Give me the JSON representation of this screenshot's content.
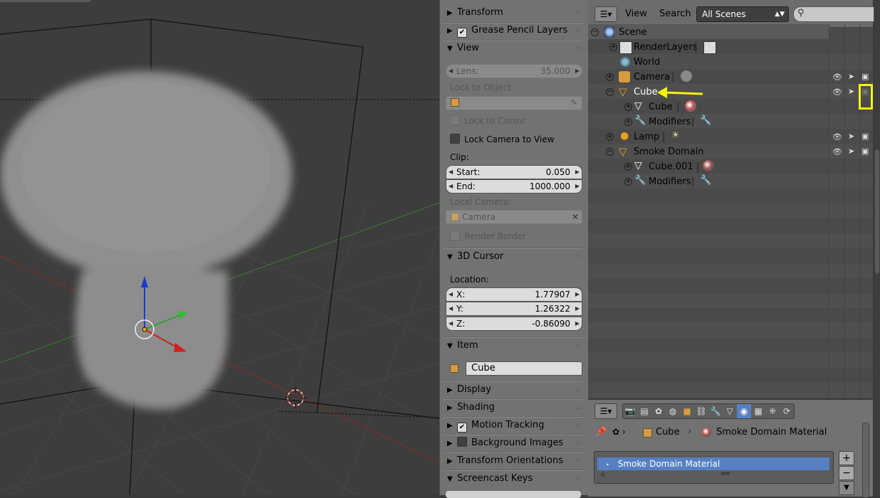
{
  "npanel": {
    "transform": "Transform",
    "grease_pencil": "Grease Pencil Layers",
    "view": "View",
    "lens_label": "Lens:",
    "lens_value": "35.000",
    "lock_to_object": "Lock to Object:",
    "lock_to_cursor": "Lock to Cursor",
    "lock_camera": "Lock Camera to View",
    "clip": "Clip:",
    "start_label": "Start:",
    "start_value": "0.050",
    "end_label": "End:",
    "end_value": "1000.000",
    "local_camera": "Local Camera:",
    "camera_field": "Camera",
    "render_border": "Render Border",
    "cursor3d": "3D Cursor",
    "location": "Location:",
    "x_label": "X:",
    "x_value": "1.77907",
    "y_label": "Y:",
    "y_value": "1.26322",
    "z_label": "Z:",
    "z_value": "-0.86090",
    "item": "Item",
    "item_name": "Cube",
    "display": "Display",
    "shading": "Shading",
    "motion_tracking": "Motion Tracking",
    "background_images": "Background Images",
    "transform_orientations": "Transform Orientations",
    "screencast_keys": "Screencast Keys"
  },
  "outliner": {
    "view_menu": "View",
    "search_menu": "Search",
    "scene_select": "All Scenes",
    "items": [
      {
        "label": "Scene"
      },
      {
        "label": "RenderLayers"
      },
      {
        "label": "World"
      },
      {
        "label": "Camera"
      },
      {
        "label": "Cube"
      },
      {
        "label": "Cube"
      },
      {
        "label": "Modifiers"
      },
      {
        "label": "Lamp"
      },
      {
        "label": "Smoke Domain"
      },
      {
        "label": "Cube.001"
      },
      {
        "label": "Modifiers"
      }
    ]
  },
  "props": {
    "breadcrumb_object": "Cube",
    "breadcrumb_material": "Smoke Domain Material",
    "material_slot": "Smoke Domain Material"
  },
  "colors": {
    "annotation": "#f5f500",
    "selected_slot": "#5680c2",
    "panel_bg": "#727272",
    "viewport_bg": "#3d3d3d"
  }
}
